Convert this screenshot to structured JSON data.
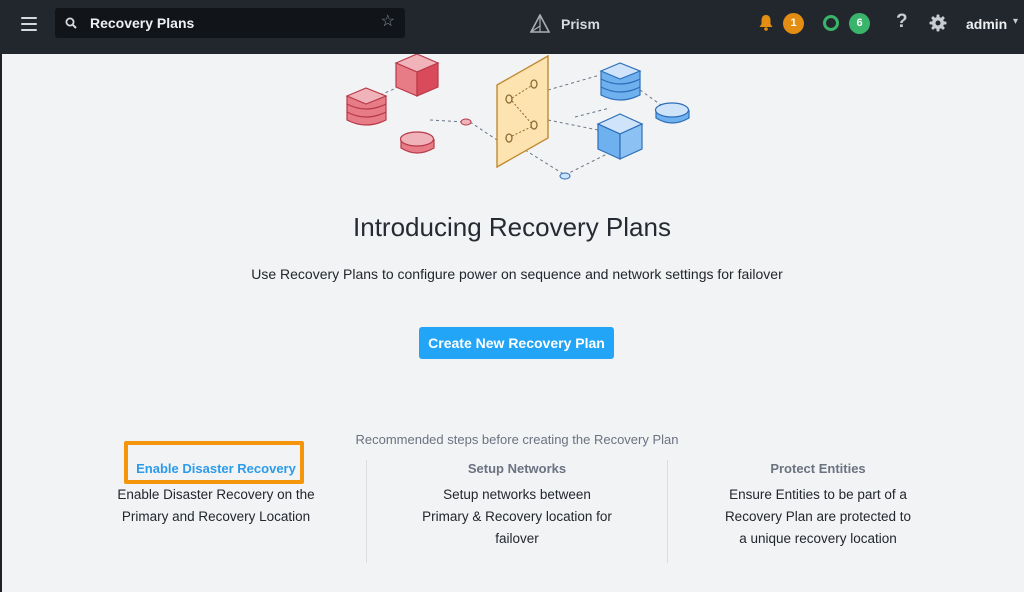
{
  "topbar": {
    "search_value": "Recovery Plans",
    "brand": "Prism",
    "alerts_count": "1",
    "tasks_count": "6",
    "help_label": "?",
    "user": "admin",
    "colors": {
      "bar": "#22272e",
      "alert_badge": "#e38d12",
      "task_badge": "#3bb46b"
    },
    "icons": [
      "menu-icon",
      "search-icon",
      "star-icon",
      "prism-logo-icon",
      "bell-icon",
      "ring-icon",
      "help-icon",
      "gear-icon",
      "chevron-down-icon"
    ]
  },
  "intro": {
    "title": "Introducing Recovery Plans",
    "subtitle": "Use Recovery Plans to configure power on sequence and network settings for failover",
    "create_button": "Create New Recovery Plan",
    "accent": "#22a5f7"
  },
  "recommended": {
    "heading": "Recommended steps before creating the Recovery Plan",
    "steps": [
      {
        "title": "Enable Disaster Recovery",
        "lines": [
          "Enable Disaster Recovery on the",
          "Primary and Recovery Location"
        ]
      },
      {
        "title": "Setup Networks",
        "lines": [
          "Setup networks between",
          "Primary & Recovery location for",
          "failover"
        ]
      },
      {
        "title": "Protect Entities",
        "lines": [
          "Ensure Entities to be part of a",
          "Recovery Plan are protected to",
          "a unique recovery location"
        ]
      }
    ],
    "highlight_color": "#f5950b"
  }
}
